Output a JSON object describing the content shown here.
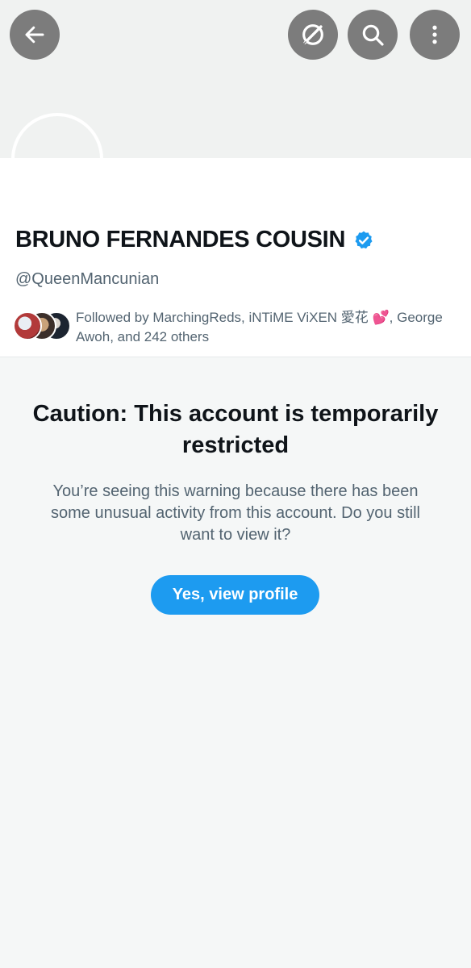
{
  "header": {
    "back_icon": "arrow-left-icon",
    "grok_icon": "grok-icon",
    "search_icon": "search-icon",
    "more_icon": "more-vertical-icon"
  },
  "profile": {
    "display_name": "BRUNO FERNANDES COUSIN",
    "verified": true,
    "handle": "@QueenMancunian",
    "followed_by": "Followed by MarchingReds, iNTiME ViXEN 愛花 💕, George Awoh, and 242 others"
  },
  "warning": {
    "title": "Caution: This account is temporarily restricted",
    "body": "You’re seeing this warning because there has been some unusual activity from this account. Do you still want to view it?",
    "button_label": "Yes, view profile"
  },
  "colors": {
    "accent": "#1d9bf0",
    "icon_button_bg": "#7c7c7c",
    "text_primary": "#0f1419",
    "text_secondary": "#536471"
  }
}
